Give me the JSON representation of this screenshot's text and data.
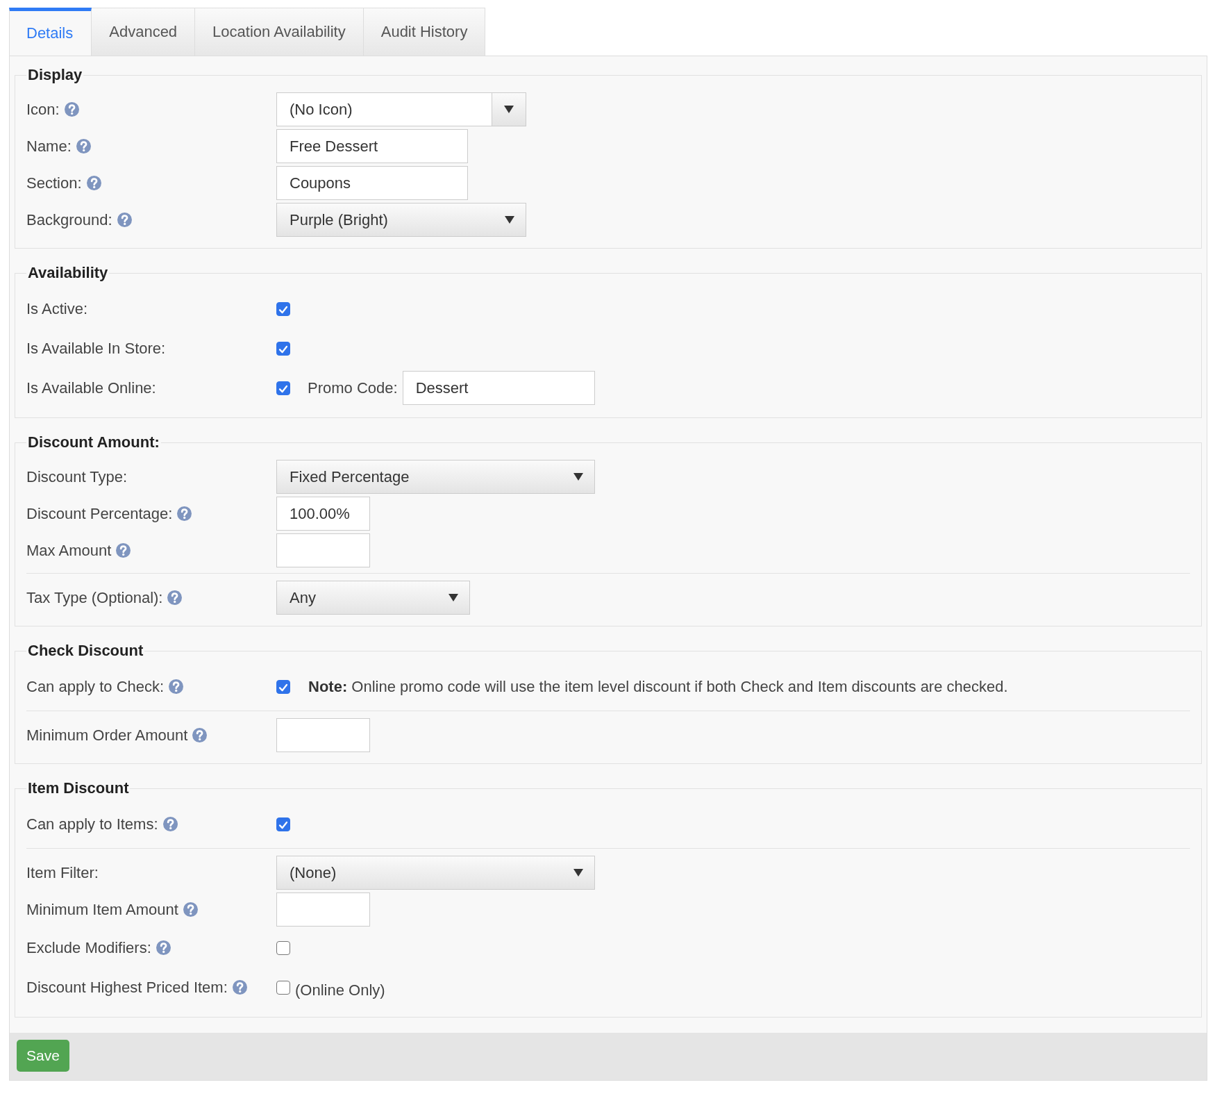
{
  "tabs": [
    {
      "label": "Details",
      "selected": true
    },
    {
      "label": "Advanced",
      "selected": false
    },
    {
      "label": "Location Availability",
      "selected": false
    },
    {
      "label": "Audit History",
      "selected": false
    }
  ],
  "sections": [
    {
      "title": "Display",
      "rows": [
        {
          "label": "Icon:",
          "help": true,
          "divider_before": false,
          "kind": "button-select",
          "value": "(No Icon)"
        },
        {
          "label": "Name:",
          "help": true,
          "divider_before": false,
          "kind": "text",
          "value": "Free Dessert"
        },
        {
          "label": "Section:",
          "help": true,
          "divider_before": false,
          "kind": "text",
          "value": "Coupons"
        },
        {
          "label": "Background:",
          "help": true,
          "divider_before": false,
          "kind": "select",
          "value": "Purple (Bright)"
        }
      ]
    },
    {
      "title": "Availability",
      "rows": [
        {
          "label": "Is Active:",
          "help": false,
          "divider_before": false,
          "kind": "checkbox",
          "checked": true
        },
        {
          "label": "Is Available In Store:",
          "help": false,
          "divider_before": false,
          "kind": "checkbox",
          "checked": true
        },
        {
          "label": "Is Available Online:",
          "help": false,
          "divider_before": false,
          "kind": "checkbox",
          "checked": true,
          "promo": {
            "label": "Promo Code:",
            "value": "Dessert"
          }
        }
      ]
    },
    {
      "title": "Discount Amount:",
      "rows": [
        {
          "label": "Discount Type:",
          "help": false,
          "divider_before": false,
          "kind": "select",
          "value": "Fixed Percentage"
        },
        {
          "label": "Discount Percentage:",
          "help": true,
          "divider_before": false,
          "kind": "text",
          "value": "100.00%"
        },
        {
          "label": "Max Amount",
          "help": true,
          "divider_before": false,
          "kind": "text"
        },
        {
          "label": "Tax Type (Optional):",
          "help": true,
          "divider_before": true,
          "kind": "select",
          "value": "Any"
        }
      ]
    },
    {
      "title": "Check Discount",
      "rows": [
        {
          "label": "Can apply to Check:",
          "help": true,
          "divider_before": false,
          "kind": "checkbox",
          "checked": true,
          "note": "**Note:** Online promo code will use the item level discount if both Check and Item discounts are checked."
        },
        {
          "label": "Minimum Order Amount",
          "help": true,
          "divider_before": true,
          "kind": "text"
        }
      ]
    },
    {
      "title": "Item Discount",
      "rows": [
        {
          "label": "Can apply to Items:",
          "help": true,
          "divider_before": false,
          "kind": "checkbox",
          "checked": true
        },
        {
          "label": "Item Filter:",
          "help": false,
          "divider_before": true,
          "kind": "select",
          "value": "(None)"
        },
        {
          "label": "Minimum Item Amount",
          "help": true,
          "divider_before": false,
          "kind": "text"
        },
        {
          "label": "Exclude Modifiers:",
          "help": true,
          "divider_before": false,
          "kind": "checkbox",
          "checked": false
        },
        {
          "label": "Discount Highest Priced Item:",
          "help": true,
          "divider_before": false,
          "kind": "checkbox",
          "checked": false,
          "suffix": "(Online Only)"
        }
      ]
    }
  ],
  "save_button": "Save"
}
